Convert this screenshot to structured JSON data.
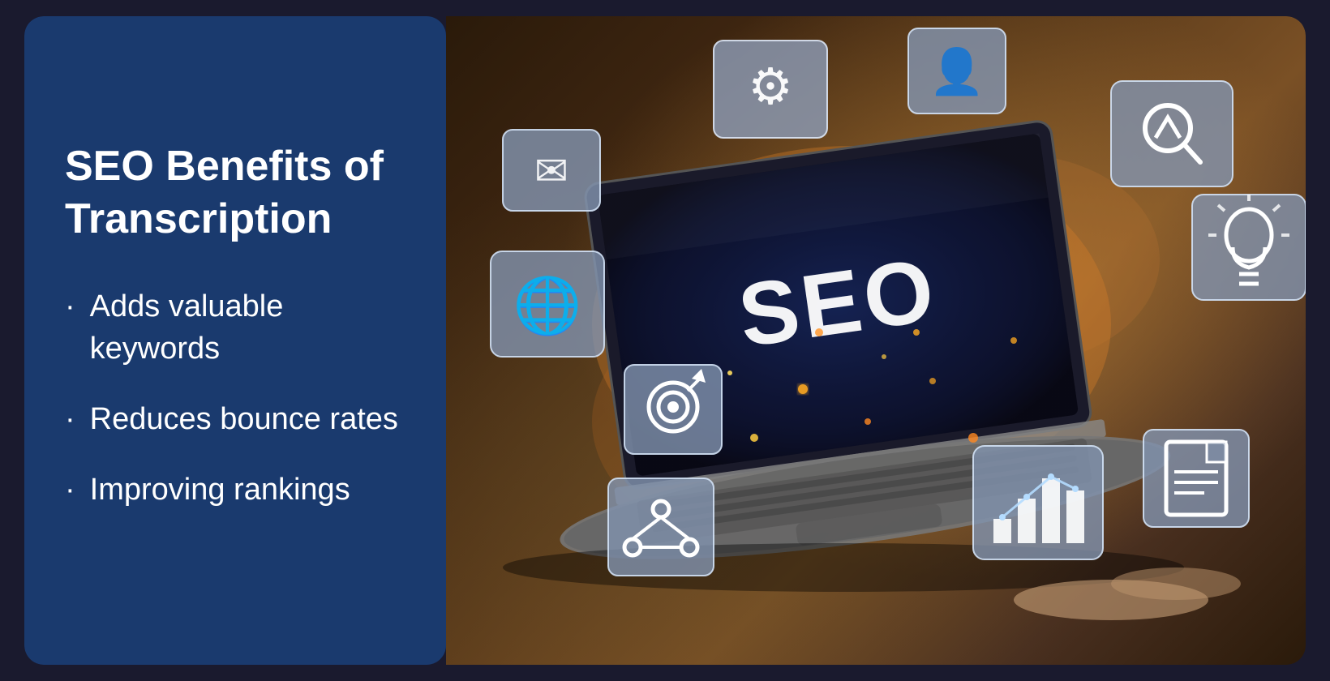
{
  "left": {
    "title_line1": "SEO Benefits of",
    "title_line2": "Transcription",
    "bullets": [
      {
        "id": "bullet-1",
        "text": "Adds valuable keywords"
      },
      {
        "id": "bullet-2",
        "text": "Reduces bounce rates"
      },
      {
        "id": "bullet-3",
        "text": "Improving rankings"
      }
    ],
    "bullet_symbol": "·"
  },
  "right": {
    "seo_label": "SEO",
    "icons": [
      {
        "id": "gear-icon",
        "symbol": "⚙",
        "label": "settings gears"
      },
      {
        "id": "person-icon",
        "symbol": "👤",
        "label": "person"
      },
      {
        "id": "envelope-icon",
        "symbol": "✉",
        "label": "email"
      },
      {
        "id": "globe-icon",
        "symbol": "🌐",
        "label": "globe"
      },
      {
        "id": "chart-magnify-icon",
        "symbol": "📈",
        "label": "chart magnify"
      },
      {
        "id": "lightbulb-icon",
        "symbol": "💡",
        "label": "lightbulb"
      },
      {
        "id": "target-icon",
        "symbol": "🎯",
        "label": "target"
      },
      {
        "id": "network-icon",
        "symbol": "🔗",
        "label": "network"
      },
      {
        "id": "bar-chart-icon",
        "symbol": "📊",
        "label": "bar chart"
      },
      {
        "id": "document-icon",
        "symbol": "📄",
        "label": "document"
      }
    ]
  },
  "colors": {
    "left_bg": "#1a3a6e",
    "title_color": "#ffffff",
    "bullet_color": "#ffffff",
    "right_bg_dark": "#2a1a0a",
    "accent_orange": "#e87820",
    "seo_text": "#ffffff"
  }
}
